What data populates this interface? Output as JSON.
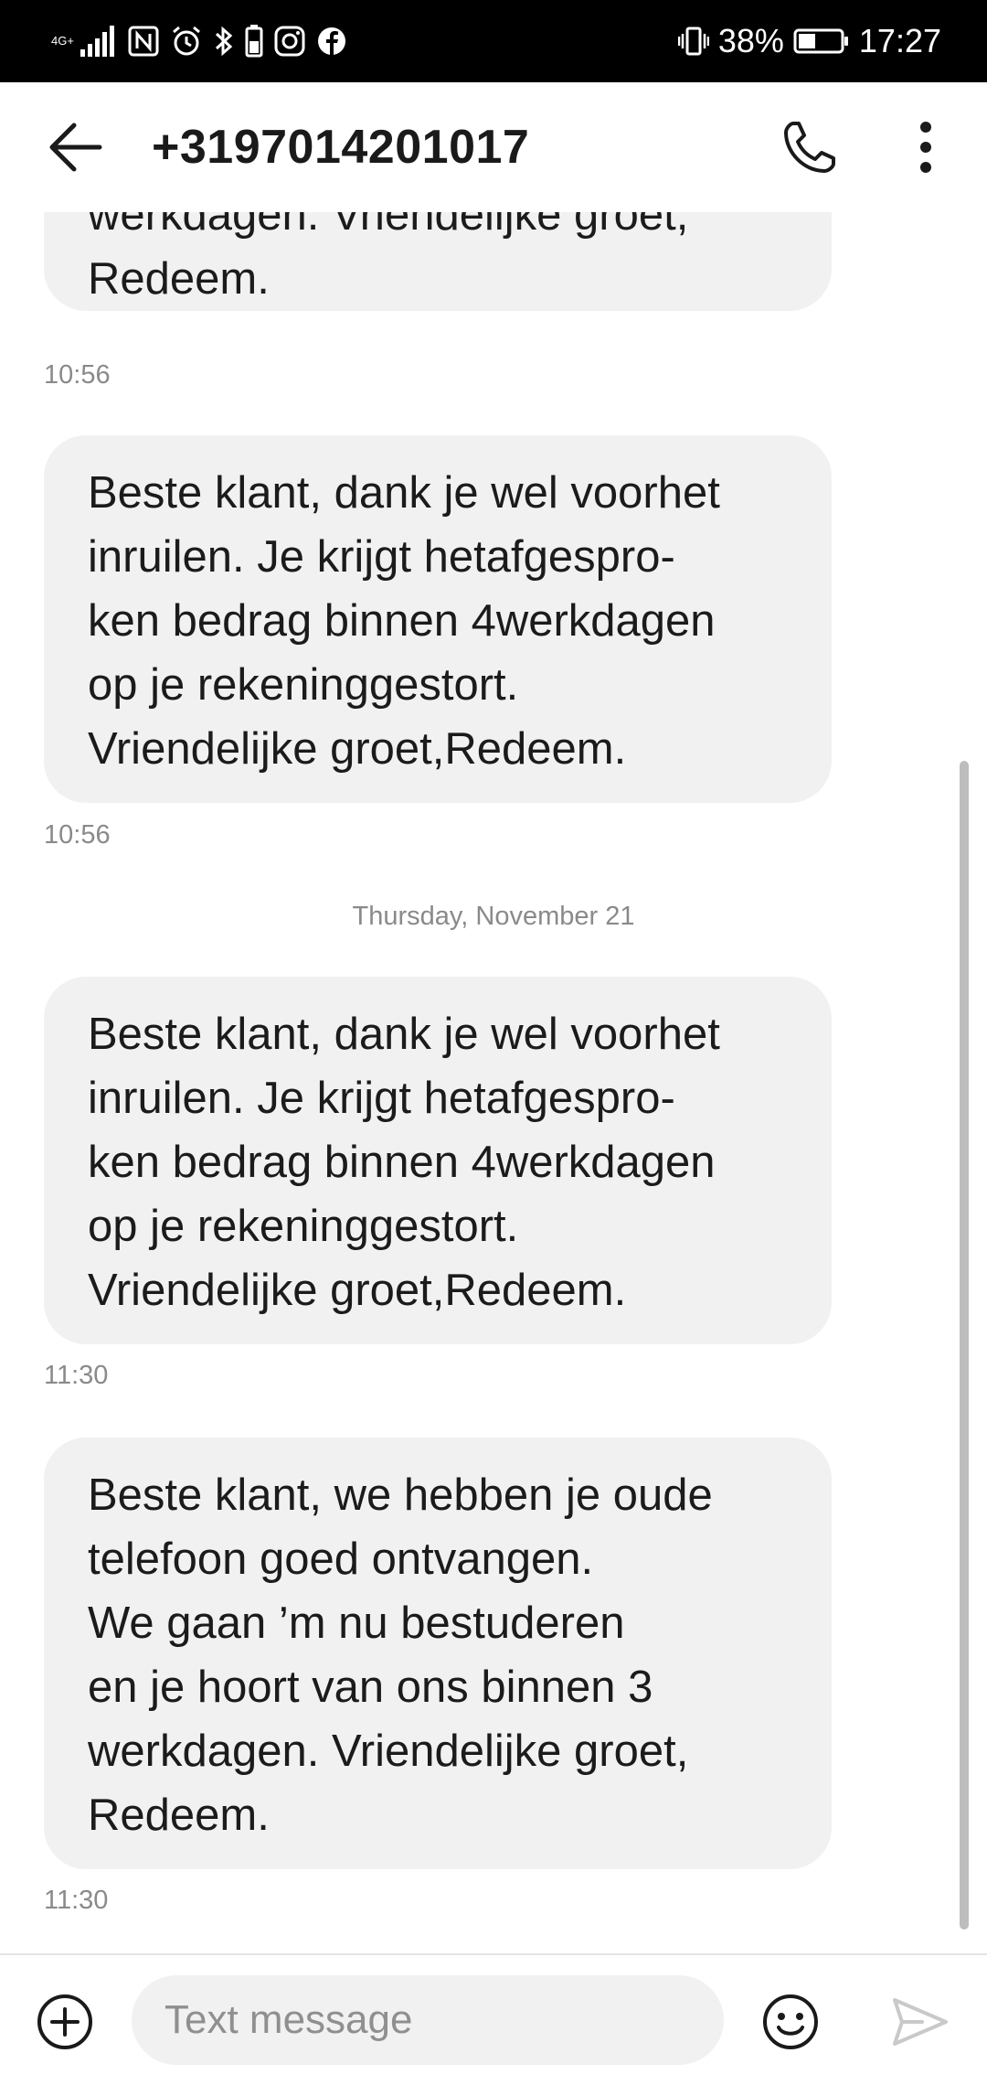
{
  "status_bar": {
    "network_label": "4G+",
    "battery": "38%",
    "time": "17:27",
    "icons": [
      "signal-icon",
      "nfc-icon",
      "alarm-icon",
      "bluetooth-icon",
      "battery-saver-icon",
      "instagram-icon",
      "facebook-icon",
      "vibrate-icon",
      "battery-icon"
    ]
  },
  "header": {
    "title": "+3197014201017",
    "icons": [
      "back-arrow-icon",
      "phone-icon",
      "more-vertical-icon"
    ]
  },
  "messages": [
    {
      "lines": [
        "werkdagen. Vriendelijke groet,",
        "Redeem."
      ],
      "time": "10:56"
    },
    {
      "lines": [
        "Beste klant, dank je wel voorhet",
        "inruilen. Je krijgt hetafgespro-",
        "ken bedrag binnen 4werkdagen",
        "op je rekeninggestort.",
        "Vriendelijke groet,Redeem."
      ],
      "time": "10:56"
    },
    {
      "date_divider": "Thursday, November 21",
      "lines": [
        "Beste klant, dank je wel voorhet",
        "inruilen. Je krijgt hetafgespro-",
        "ken bedrag binnen 4werkdagen",
        "op je rekeninggestort.",
        "Vriendelijke groet,Redeem."
      ],
      "time": "11:30"
    },
    {
      "lines": [
        "Beste klant, we hebben je oude",
        "telefoon goed ontvangen.",
        "We gaan ’m nu bestuderen",
        "en je hoort van ons binnen 3",
        "werkdagen. Vriendelijke groet,",
        "Redeem."
      ],
      "time": "11:30"
    }
  ],
  "compose": {
    "placeholder": "Text message",
    "value": "",
    "icons": [
      "add-circle-icon",
      "emoji-icon",
      "send-icon"
    ]
  },
  "colors": {
    "status_bar_bg": "#000000",
    "bubble_bg": "#f1f1f1",
    "text_primary": "#1b1b1b",
    "text_secondary": "#8a8a8a",
    "icon_primary": "#1a1a1a",
    "send_disabled": "#c9c9c9"
  }
}
